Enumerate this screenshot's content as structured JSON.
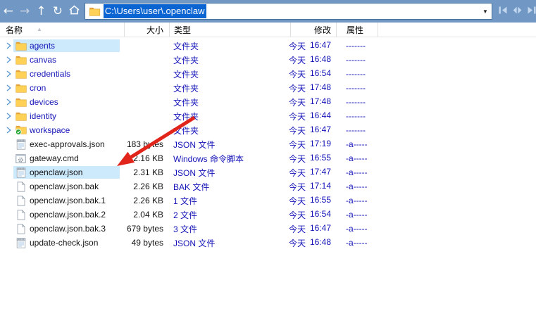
{
  "toolbar": {
    "address_value": "C:\\Users\\user\\.openclaw"
  },
  "columns": {
    "name": "名称",
    "size": "大小",
    "type": "类型",
    "modified": "修改",
    "attributes": "属性"
  },
  "sort": {
    "column": "名称",
    "direction": "ascending",
    "glyph": "▲"
  },
  "rows": [
    {
      "name": "agents",
      "icon": "folder-icon",
      "is_folder": true,
      "size": "",
      "type": "文件夹",
      "modified_day": "今天",
      "modified_time": "16:47",
      "attributes": "-------",
      "highlighted": true
    },
    {
      "name": "canvas",
      "icon": "folder-icon",
      "is_folder": true,
      "size": "",
      "type": "文件夹",
      "modified_day": "今天",
      "modified_time": "16:48",
      "attributes": "-------",
      "highlighted": false
    },
    {
      "name": "credentials",
      "icon": "folder-icon",
      "is_folder": true,
      "size": "",
      "type": "文件夹",
      "modified_day": "今天",
      "modified_time": "16:54",
      "attributes": "-------",
      "highlighted": false
    },
    {
      "name": "cron",
      "icon": "folder-icon",
      "is_folder": true,
      "size": "",
      "type": "文件夹",
      "modified_day": "今天",
      "modified_time": "17:48",
      "attributes": "-------",
      "highlighted": false
    },
    {
      "name": "devices",
      "icon": "folder-icon",
      "is_folder": true,
      "size": "",
      "type": "文件夹",
      "modified_day": "今天",
      "modified_time": "17:48",
      "attributes": "-------",
      "highlighted": false
    },
    {
      "name": "identity",
      "icon": "folder-icon",
      "is_folder": true,
      "size": "",
      "type": "文件夹",
      "modified_day": "今天",
      "modified_time": "16:44",
      "attributes": "-------",
      "highlighted": false
    },
    {
      "name": "workspace",
      "icon": "folder-check-icon",
      "is_folder": true,
      "size": "",
      "type": "文件夹",
      "modified_day": "今天",
      "modified_time": "16:47",
      "attributes": "-------",
      "highlighted": false
    },
    {
      "name": "exec-approvals.json",
      "icon": "notepad-icon",
      "is_folder": false,
      "size": "183 bytes",
      "type": "JSON 文件",
      "modified_day": "今天",
      "modified_time": "17:19",
      "attributes": "-a-----",
      "highlighted": false
    },
    {
      "name": "gateway.cmd",
      "icon": "cmd-script-icon",
      "is_folder": false,
      "size": "2.16 KB",
      "type": "Windows 命令脚本",
      "modified_day": "今天",
      "modified_time": "16:55",
      "attributes": "-a-----",
      "highlighted": false
    },
    {
      "name": "openclaw.json",
      "icon": "notepad-icon",
      "is_folder": false,
      "size": "2.31 KB",
      "type": "JSON 文件",
      "modified_day": "今天",
      "modified_time": "17:47",
      "attributes": "-a-----",
      "highlighted": true
    },
    {
      "name": "openclaw.json.bak",
      "icon": "blank-file-icon",
      "is_folder": false,
      "size": "2.26 KB",
      "type": "BAK 文件",
      "modified_day": "今天",
      "modified_time": "17:14",
      "attributes": "-a-----",
      "highlighted": false
    },
    {
      "name": "openclaw.json.bak.1",
      "icon": "blank-file-icon",
      "is_folder": false,
      "size": "2.26 KB",
      "type": "1 文件",
      "modified_day": "今天",
      "modified_time": "16:55",
      "attributes": "-a-----",
      "highlighted": false
    },
    {
      "name": "openclaw.json.bak.2",
      "icon": "blank-file-icon",
      "is_folder": false,
      "size": "2.04 KB",
      "type": "2 文件",
      "modified_day": "今天",
      "modified_time": "16:54",
      "attributes": "-a-----",
      "highlighted": false
    },
    {
      "name": "openclaw.json.bak.3",
      "icon": "blank-file-icon",
      "is_folder": false,
      "size": "679 bytes",
      "type": "3 文件",
      "modified_day": "今天",
      "modified_time": "16:47",
      "attributes": "-a-----",
      "highlighted": false
    },
    {
      "name": "update-check.json",
      "icon": "notepad-icon",
      "is_folder": false,
      "size": "49 bytes",
      "type": "JSON 文件",
      "modified_day": "今天",
      "modified_time": "16:48",
      "attributes": "-a-----",
      "highlighted": false
    }
  ],
  "annotation": {
    "shape": "arrow",
    "color": "#e1251b",
    "points_at": "openclaw.json"
  },
  "colors": {
    "toolbar_bg": "#7197c4",
    "address_selection_bg": "#0a64d2",
    "address_selection_text": "#ffffff",
    "row_highlight_bg": "#cde9fc",
    "folder_name_text": "#1414b8",
    "file_name_text": "#141414",
    "meta_text": "#1414b8",
    "folder_icon_yellow": "#ffd157",
    "sync_check_green": "#27a93c"
  }
}
